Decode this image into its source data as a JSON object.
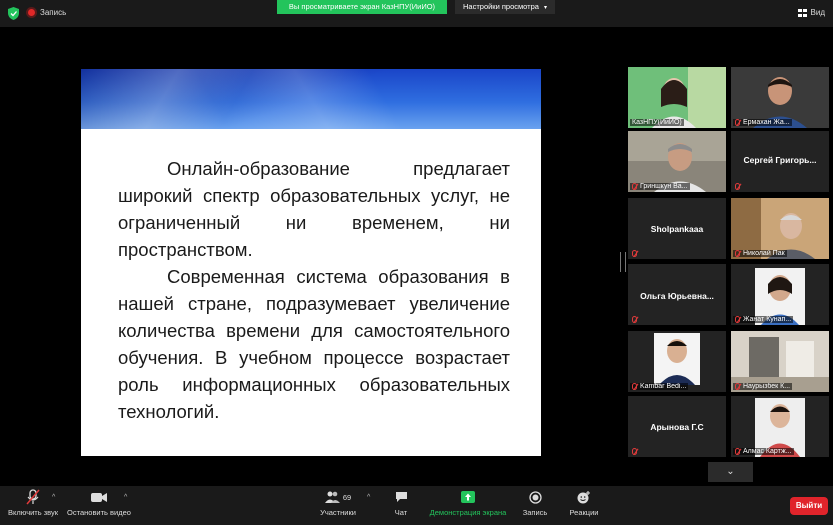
{
  "topbar": {
    "recording_label": "Запись",
    "share_banner": "Вы просматриваете экран КазНПУ(ИиИО)",
    "view_options": "Настройки просмотра",
    "view_mode": "Вид"
  },
  "slide": {
    "paragraph1": "Онлайн-образование предлагает широкий спектр образовательных услуг, не ограниченный ни временем, ни пространством.",
    "paragraph2": "Современная система образования в нашей стране, подразумевает увеличение количества времени для самостоятельного обучения. В учебном процессе возрастает роль информационных образовательных технологий."
  },
  "participants": [
    {
      "label": "КазНПУ(ИиИО)",
      "name_center": ""
    },
    {
      "label": "Ермахан Жа...",
      "name_center": ""
    },
    {
      "label": "Гриншкун Ва...",
      "name_center": ""
    },
    {
      "label": "",
      "name_center": "Сергей Григорь..."
    },
    {
      "label": "",
      "name_center": "Sholpankaaa"
    },
    {
      "label": "Николай Пак",
      "name_center": ""
    },
    {
      "label": "",
      "name_center": "Ольга Юрьевна..."
    },
    {
      "label": "Жанат Кунап...",
      "name_center": ""
    },
    {
      "label": "Kambar Bedi...",
      "name_center": ""
    },
    {
      "label": "Наурызбек К...",
      "name_center": ""
    },
    {
      "label": "",
      "name_center": "Арынова Г.С"
    },
    {
      "label": "Алмас Картж...",
      "name_center": ""
    }
  ],
  "toolbar": {
    "unmute": "Включить звук",
    "stop_video": "Остановить видео",
    "participants": "Участники",
    "participants_count": "69",
    "chat": "Чат",
    "share_screen": "Демонстрация экрана",
    "record": "Запись",
    "reactions": "Реакции",
    "leave": "Выйти"
  },
  "colors": {
    "share_green": "#23c45c",
    "leave_red": "#e0242b",
    "active_speaker": "#f7d24a"
  }
}
